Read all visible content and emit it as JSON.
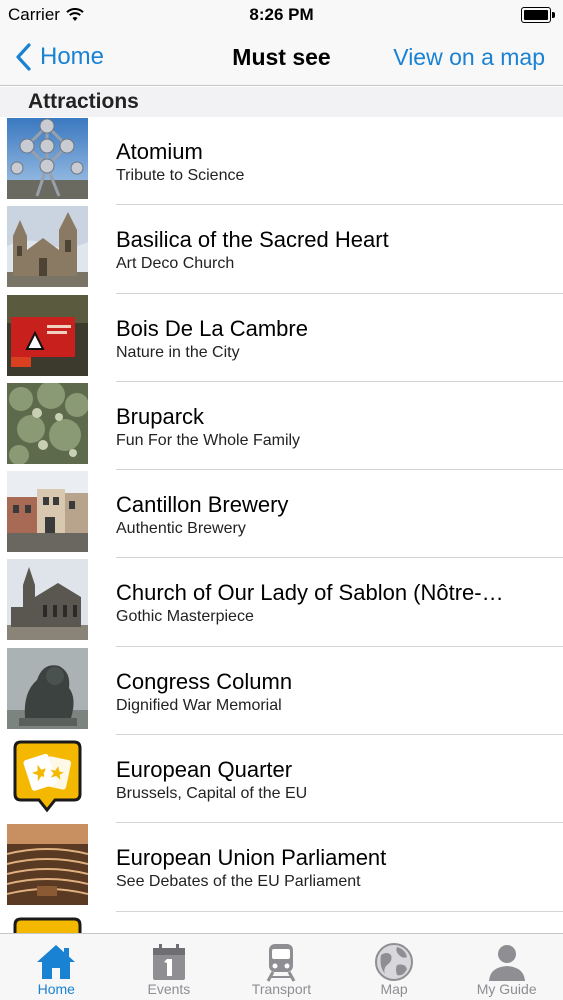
{
  "status_bar": {
    "carrier": "Carrier",
    "time": "8:26 PM"
  },
  "nav": {
    "back_label": "Home",
    "title": "Must see",
    "right_action": "View on a map"
  },
  "section": {
    "title": "Attractions"
  },
  "items": [
    {
      "title": "Atomium",
      "subtitle": "Tribute to Science",
      "thumb": "atomium-photo"
    },
    {
      "title": "Basilica of the Sacred Heart",
      "subtitle": "Art Deco Church",
      "thumb": "basilica-photo"
    },
    {
      "title": "Bois De La Cambre",
      "subtitle": "Nature in the City",
      "thumb": "bois-de-la-cambre-photo"
    },
    {
      "title": "Bruparck",
      "subtitle": "Fun For the Whole Family",
      "thumb": "bruparck-photo"
    },
    {
      "title": "Cantillon Brewery",
      "subtitle": "Authentic Brewery",
      "thumb": "cantillon-brewery-photo"
    },
    {
      "title": "Church of Our Lady of Sablon (Nôtre-…",
      "subtitle": "Gothic Masterpiece",
      "thumb": "sablon-church-photo"
    },
    {
      "title": "Congress Column",
      "subtitle": "Dignified War Memorial",
      "thumb": "congress-column-photo"
    },
    {
      "title": "European Quarter",
      "subtitle": "Brussels, Capital of the EU",
      "thumb": "placeholder-tickets-icon"
    },
    {
      "title": "European Union Parliament",
      "subtitle": "See Debates of the EU Parliament",
      "thumb": "eu-parliament-photo"
    }
  ],
  "tabs": [
    {
      "label": "Home",
      "icon": "home-icon",
      "active": true
    },
    {
      "label": "Events",
      "icon": "calendar-icon",
      "active": false
    },
    {
      "label": "Transport",
      "icon": "train-icon",
      "active": false
    },
    {
      "label": "Map",
      "icon": "globe-icon",
      "active": false
    },
    {
      "label": "My Guide",
      "icon": "person-icon",
      "active": false
    }
  ],
  "colors": {
    "accent": "#1a82d3",
    "tab_inactive": "#8e8e93",
    "placeholder_icon": "#f5b800"
  }
}
